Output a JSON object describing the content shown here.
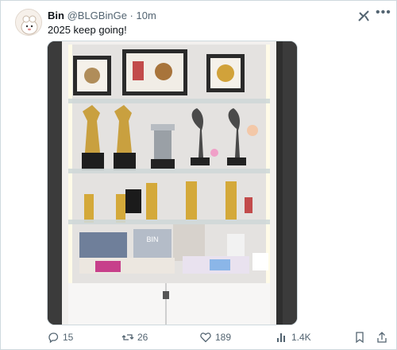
{
  "tweet": {
    "author": {
      "display_name": "Bin",
      "handle": "@BLGBinGe",
      "separator": "·",
      "time": "10m"
    },
    "text": "2025 keep going!",
    "actions": {
      "replies": "15",
      "retweets": "26",
      "likes": "189",
      "views": "1.4K"
    },
    "media": {
      "printed_text": [
        "BIN"
      ]
    }
  },
  "icons": {
    "grok": "grok-icon",
    "more": "more-icon",
    "reply": "reply-icon",
    "retweet": "retweet-icon",
    "like": "heart-icon",
    "views": "analytics-icon",
    "bookmark": "bookmark-icon",
    "share": "share-icon"
  },
  "colors": {
    "text": "#0f1419",
    "secondary": "#536471",
    "border": "#cfd9de"
  }
}
